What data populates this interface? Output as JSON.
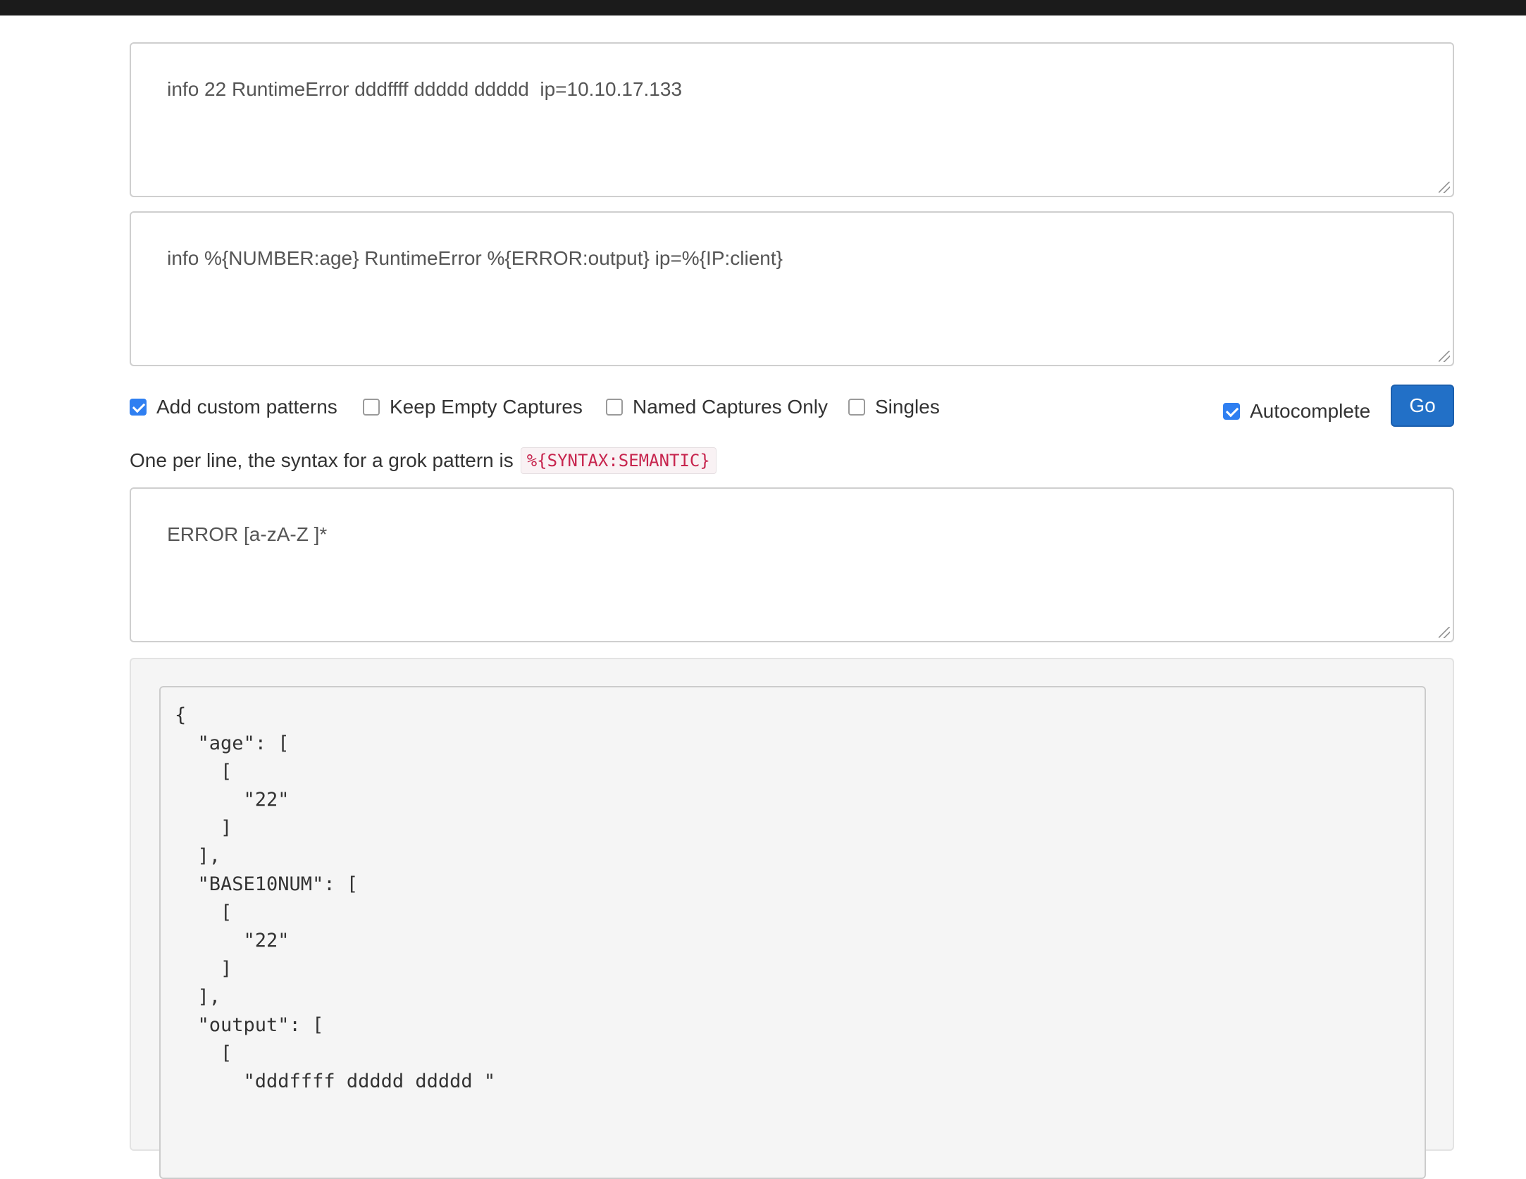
{
  "input": {
    "log_line": "info 22 RuntimeError dddffff ddddd ddddd  ip=10.10.17.133",
    "pattern": "info %{NUMBER:age} RuntimeError %{ERROR:output} ip=%{IP:client}"
  },
  "options": {
    "add_custom_patterns": {
      "label": "Add custom patterns",
      "checked": true
    },
    "keep_empty_captures": {
      "label": "Keep Empty Captures",
      "checked": false
    },
    "named_captures_only": {
      "label": "Named Captures Only",
      "checked": false
    },
    "singles": {
      "label": "Singles",
      "checked": false
    },
    "autocomplete": {
      "label": "Autocomplete",
      "checked": true
    },
    "go_label": "Go"
  },
  "custom_patterns": {
    "hint_text": "One per line, the syntax for a grok pattern is",
    "hint_code": "%{SYNTAX:SEMANTIC}",
    "value": "ERROR [a-zA-Z ]*"
  },
  "output": {
    "json_lines": [
      "{",
      "  \"age\": [",
      "    [",
      "      \"22\"",
      "    ]",
      "  ],",
      "  \"BASE10NUM\": [",
      "    [",
      "      \"22\"",
      "    ]",
      "  ],",
      "  \"output\": [",
      "    [",
      "      \"dddffff ddddd ddddd \""
    ]
  },
  "colors": {
    "accent": "#2f7ff1",
    "button": "#2270c7",
    "code_text": "#c7254e",
    "topbar": "#1b1b1b"
  }
}
